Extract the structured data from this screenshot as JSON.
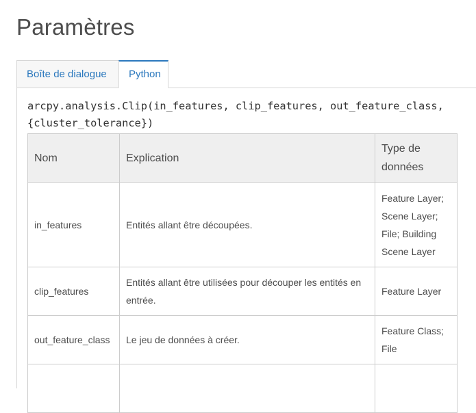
{
  "page": {
    "title": "Paramètres"
  },
  "tabs": [
    {
      "label": "Boîte de dialogue",
      "active": false
    },
    {
      "label": "Python",
      "active": true
    }
  ],
  "syntax": "arcpy.analysis.Clip(in_features, clip_features, out_feature_class,\n{cluster_tolerance})",
  "table": {
    "headers": [
      "Nom",
      "Explication",
      "Type de données"
    ],
    "rows": [
      {
        "name": "in_features",
        "explanation": "Entités allant être découpées.",
        "type": "Feature Layer; Scene Layer; File; Building Scene Layer"
      },
      {
        "name": "clip_features",
        "explanation": "Entités allant être utilisées pour découper les entités en entrée.",
        "type": "Feature Layer"
      },
      {
        "name": "out_feature_class",
        "explanation": "Le jeu de données à créer.",
        "type": "Feature Class; File"
      },
      {
        "name": "",
        "explanation": "",
        "type": ""
      }
    ]
  },
  "colors": {
    "accent": "#2b78bd",
    "header_bg": "#efefef",
    "border": "#cccccc",
    "text": "#4c4c4c"
  }
}
